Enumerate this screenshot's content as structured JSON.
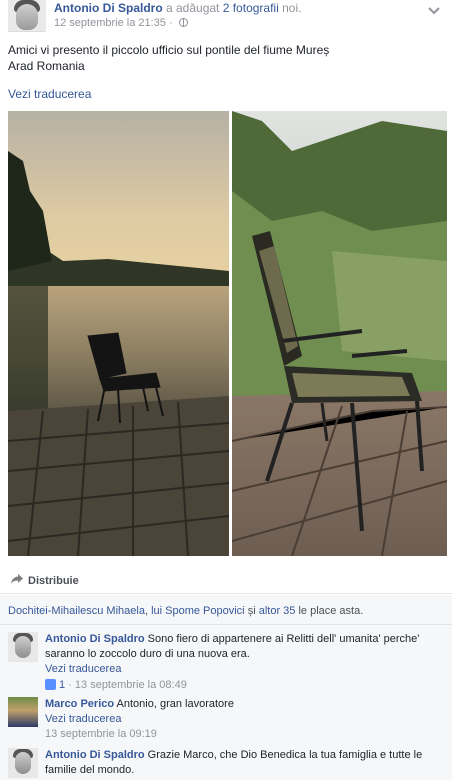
{
  "post": {
    "author": "Antonio Di Spaldro",
    "action_prefix": " a adăugat ",
    "action_link": "2 fotografii",
    "action_suffix": " noi.",
    "timestamp": "12 septembrie la 21:35",
    "privacy_separator": " · ",
    "text_line1": "Amici vi presento il piccolo ufficio sul pontile del fiume Mureș",
    "text_line2": "Arad Romania",
    "see_translation": "Vezi traducerea"
  },
  "actions": {
    "share_label": "Distribuie"
  },
  "likes": {
    "person1": "Dochitei-Mihailescu Mihaela",
    "sep1": ", ",
    "person2": "lui Spome Popovici",
    "and": " și ",
    "others": "altor 35",
    "suffix": " le place asta."
  },
  "comments": [
    {
      "author": "Antonio Di Spaldro",
      "text": "Sono fiero di appartenere ai Relitti dell' umanita' perche' saranno lo zoccolo duro di una nuova era.",
      "see_translation": "Vezi traducerea",
      "like_count": "1",
      "separator": " · ",
      "timestamp": "13 septembrie la 08:49"
    },
    {
      "author": "Marco Perico",
      "text": "Antonio, gran lavoratore",
      "see_translation": "Vezi traducerea",
      "timestamp": "13 septembrie la 09:19"
    },
    {
      "author": "Antonio Di Spaldro",
      "text": "Grazie Marco, che Dio Benedica la tua famiglia e tutte le familie del mondo."
    }
  ],
  "icons": {
    "chevron": "chevron-down-icon",
    "globe": "globe-icon",
    "share": "share-arrow-icon",
    "like": "like-thumb-icon"
  },
  "colors": {
    "link": "#365899",
    "meta": "#90949c",
    "feedback_bg": "#f6f7f9",
    "like_blue": "#5890ff"
  }
}
